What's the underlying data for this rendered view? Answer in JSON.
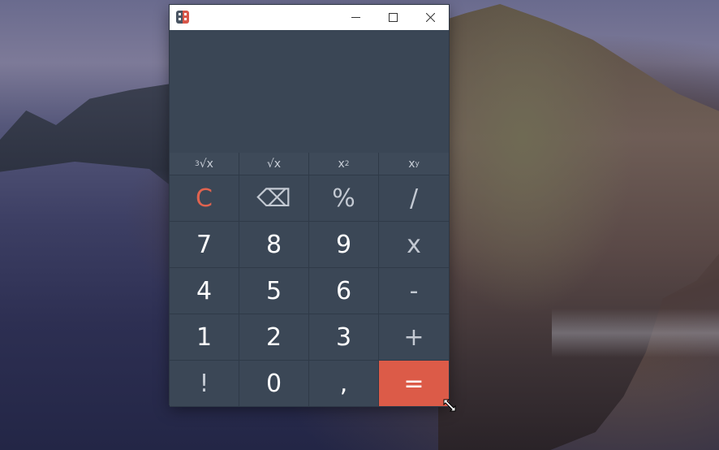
{
  "window": {
    "title": "",
    "controls": [
      "minimize-icon",
      "maximize-icon",
      "close-icon"
    ]
  },
  "display": {
    "value": ""
  },
  "function_keys": [
    {
      "base": "√x",
      "sup": "3",
      "sup_before": true
    },
    {
      "base": "√x",
      "sup": "",
      "sup_before": false
    },
    {
      "base": "x",
      "sup": "2",
      "sup_before": false
    },
    {
      "base": "x",
      "sup": "y",
      "sup_before": false
    }
  ],
  "keys": {
    "row1": [
      "C",
      "⌫",
      "%",
      "/"
    ],
    "row2": [
      "7",
      "8",
      "9",
      "x"
    ],
    "row3": [
      "4",
      "5",
      "6",
      "-"
    ],
    "row4": [
      "1",
      "2",
      "3",
      "+"
    ],
    "row5": [
      "!",
      "0",
      ",",
      "="
    ]
  },
  "colors": {
    "window_bg": "#3a4655",
    "equals_bg": "#dc5b48",
    "clear_text": "#e0634f"
  }
}
